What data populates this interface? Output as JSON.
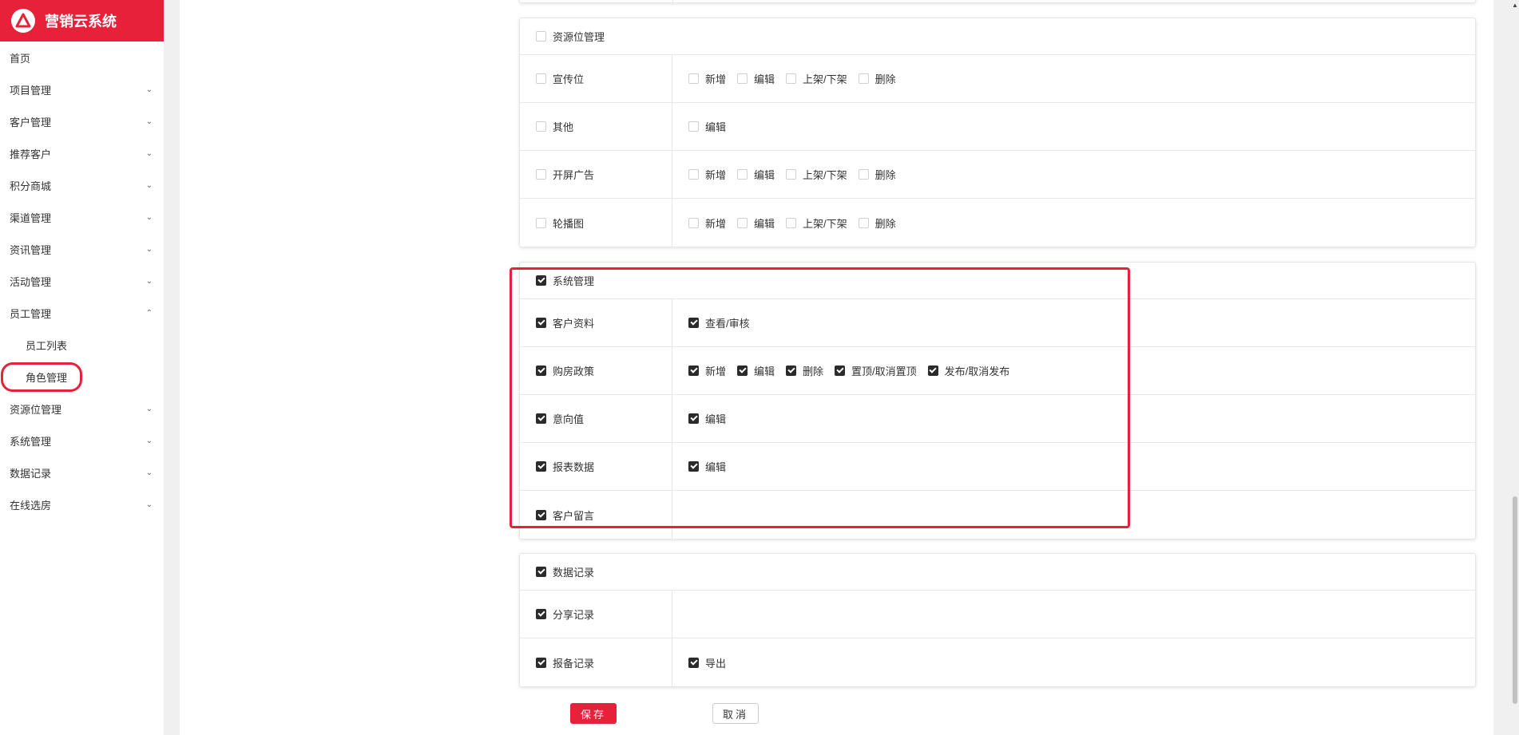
{
  "app": {
    "title": "营销云系统",
    "logo_icon": "brand-logo-icon",
    "brand_color": "#e8213a"
  },
  "sidebar": {
    "home": "首页",
    "items": [
      {
        "label": "项目管理"
      },
      {
        "label": "客户管理"
      },
      {
        "label": "推荐客户"
      },
      {
        "label": "积分商城"
      },
      {
        "label": "渠道管理"
      },
      {
        "label": "资讯管理"
      },
      {
        "label": "活动管理"
      },
      {
        "label": "员工管理"
      }
    ],
    "sub_items": [
      {
        "label": "员工列表"
      },
      {
        "label": "角色管理"
      }
    ],
    "items_after": [
      {
        "label": "资源位管理"
      },
      {
        "label": "系统管理"
      },
      {
        "label": "数据记录"
      },
      {
        "label": "在线选房"
      }
    ]
  },
  "cards": {
    "resource": {
      "title": "资源位管理",
      "checked": false,
      "rows": [
        {
          "label": "宣传位",
          "perms": [
            "新增",
            "编辑",
            "上架/下架",
            "删除"
          ]
        },
        {
          "label": "其他",
          "perms": [
            "编辑"
          ]
        },
        {
          "label": "开屏广告",
          "perms": [
            "新增",
            "编辑",
            "上架/下架",
            "删除"
          ]
        },
        {
          "label": "轮播图",
          "perms": [
            "新增",
            "编辑",
            "上架/下架",
            "删除"
          ]
        }
      ]
    },
    "system": {
      "title": "系统管理",
      "checked": true,
      "rows": [
        {
          "label": "客户资料",
          "perms": [
            "查看/审核"
          ]
        },
        {
          "label": "购房政策",
          "perms": [
            "新增",
            "编辑",
            "删除",
            "置顶/取消置顶",
            "发布/取消发布"
          ]
        },
        {
          "label": "意向值",
          "perms": [
            "编辑"
          ]
        },
        {
          "label": "报表数据",
          "perms": [
            "编辑"
          ]
        },
        {
          "label": "客户留言",
          "perms": []
        }
      ]
    },
    "data": {
      "title": "数据记录",
      "checked": true,
      "rows": [
        {
          "label": "分享记录",
          "perms": []
        },
        {
          "label": "报备记录",
          "perms": [
            "导出"
          ]
        }
      ]
    }
  },
  "actions": {
    "save": "保存",
    "cancel": "取消"
  }
}
